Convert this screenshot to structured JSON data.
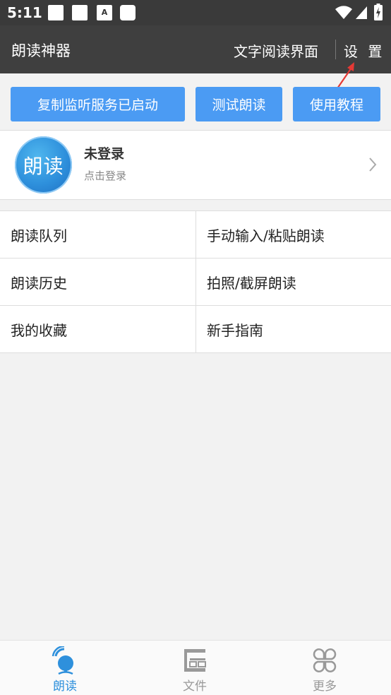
{
  "status_bar": {
    "time": "5:11",
    "icon_a": "A"
  },
  "app_bar": {
    "title": "朗读神器",
    "reader_link": "文字阅读界面",
    "settings": "设 置"
  },
  "buttons": {
    "clipboard_service": "复制监听服务已启动",
    "test_read": "测试朗读",
    "tutorial": "使用教程"
  },
  "account": {
    "avatar_text": "朗读",
    "name": "未登录",
    "hint": "点击登录"
  },
  "menu": [
    "朗读队列",
    "手动输入/粘贴朗读",
    "朗读历史",
    "拍照/截屏朗读",
    "我的收藏",
    "新手指南"
  ],
  "bottom_nav": [
    {
      "label": "朗读",
      "icon": "reader-icon",
      "active": true
    },
    {
      "label": "文件",
      "icon": "file-icon",
      "active": false
    },
    {
      "label": "更多",
      "icon": "more-icon",
      "active": false
    }
  ],
  "colors": {
    "accent": "#4b9bf3",
    "appbar": "#3f3f3f",
    "annotation_arrow": "#e53935"
  }
}
